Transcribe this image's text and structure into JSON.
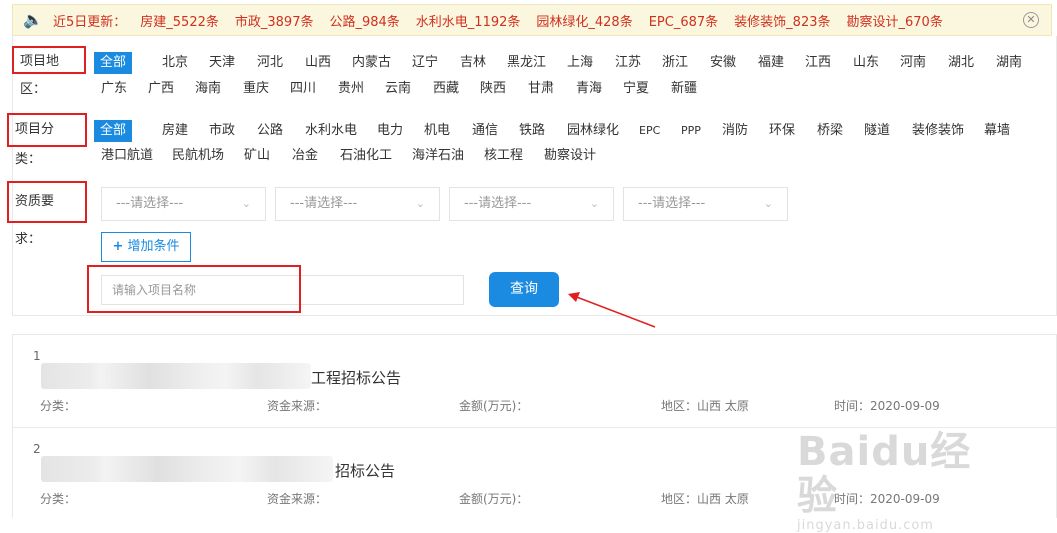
{
  "notice": {
    "label": "近5日更新：",
    "items": [
      "房建_5522条",
      "市政_3897条",
      "公路_984条",
      "水利水电_1192条",
      "园林绿化_428条",
      "EPC_687条",
      "装修装饰_823条",
      "勘察设计_670条"
    ],
    "close_icon": "close-circle-icon"
  },
  "region": {
    "label": "项目地区：",
    "items": [
      "全部",
      "北京",
      "天津",
      "河北",
      "山西",
      "内蒙古",
      "辽宁",
      "吉林",
      "黑龙江",
      "上海",
      "江苏",
      "浙江",
      "安徽",
      "福建",
      "江西",
      "山东",
      "河南",
      "湖北",
      "湖南",
      "广东",
      "广西",
      "海南",
      "重庆",
      "四川",
      "贵州",
      "云南",
      "西藏",
      "陕西",
      "甘肃",
      "青海",
      "宁夏",
      "新疆"
    ],
    "active": "全部"
  },
  "category": {
    "label": "项目分类：",
    "items": [
      "全部",
      "房建",
      "市政",
      "公路",
      "水利水电",
      "电力",
      "机电",
      "通信",
      "铁路",
      "园林绿化",
      "EPC",
      "PPP",
      "消防",
      "环保",
      "桥梁",
      "隧道",
      "装修装饰",
      "幕墙",
      "港口航道",
      "民航机场",
      "矿山",
      "冶金",
      "石油化工",
      "海洋石油",
      "核工程",
      "勘察设计"
    ],
    "active": "全部"
  },
  "qualification": {
    "label": "资质要求：",
    "selects": [
      "---请选择---",
      "---请选择---",
      "---请选择---",
      "---请选择---"
    ],
    "add_label": "增加条件"
  },
  "search": {
    "placeholder": "请输入项目名称",
    "button": "查询"
  },
  "results": [
    {
      "num": "1",
      "title": "工程招标公告",
      "category": "分类：",
      "fund": "资金来源：",
      "amount": "金额(万元)：",
      "region": "地区：山西 太原",
      "time": "时间：2020-09-09"
    },
    {
      "num": "2",
      "title": "招标公告",
      "category": "分类：",
      "fund": "资金来源：",
      "amount": "金额(万元)：",
      "region": "地区：山西 太原",
      "time": "时间：2020-09-09"
    }
  ],
  "watermark": {
    "brand": "Baidu经验",
    "url": "jingyan.baidu.com"
  },
  "colors": {
    "accent": "#1a8be0",
    "notice_text": "#d0301e",
    "highlight_box": "#e02020"
  }
}
